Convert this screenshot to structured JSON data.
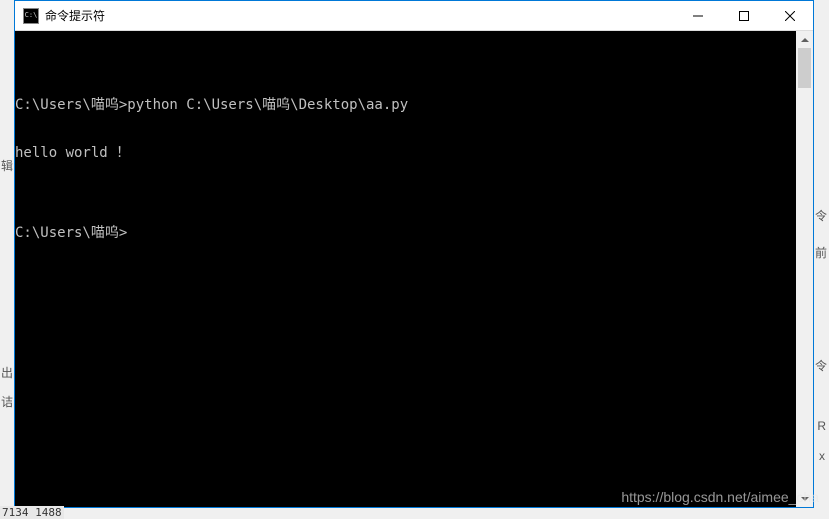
{
  "window": {
    "title": "命令提示符",
    "icon_text": "C:\\"
  },
  "terminal": {
    "lines": [
      "",
      "C:\\Users\\喵呜>python C:\\Users\\喵呜\\Desktop\\aa.py",
      "hello world ！",
      "",
      "C:\\Users\\喵呜>"
    ]
  },
  "watermark": "https://blog.csdn.net/aimee_cha",
  "background": {
    "bottom_status": "7134 1488"
  },
  "clutter": {
    "c1": "辑",
    "c2": "令",
    "c3": "令",
    "c4": "前",
    "c5": "出",
    "c6": "诘",
    "c7": "x",
    "c8": "R"
  }
}
